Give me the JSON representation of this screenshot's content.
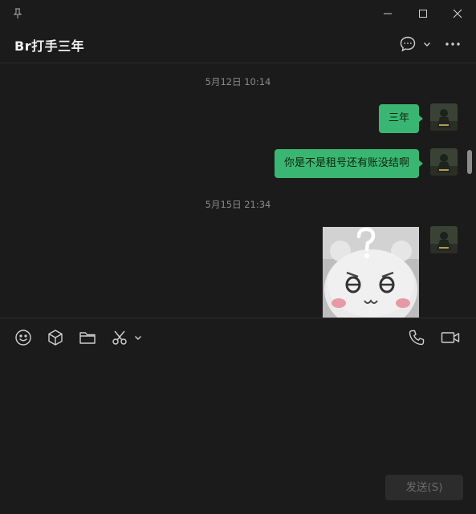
{
  "header": {
    "title": "Br打手三年"
  },
  "messages": {
    "timestamps": [
      "5月12日 10:14",
      "5月15日 21:34"
    ],
    "items": [
      {
        "type": "text",
        "sender": "self",
        "text": "三年"
      },
      {
        "type": "text",
        "sender": "self",
        "text": "你是不是租号还有账没结啊"
      },
      {
        "type": "image",
        "sender": "self"
      }
    ],
    "bubble_color": "#39b772"
  },
  "send": {
    "label": "发送(S)"
  },
  "icons": {
    "titlebar": [
      "pin-icon",
      "minimize-icon",
      "maximize-icon",
      "close-icon"
    ],
    "header": [
      "chat-bubble-icon",
      "chevron-down-icon",
      "more-icon"
    ],
    "toolbar": [
      "emoji-icon",
      "box-icon",
      "folder-icon",
      "scissors-icon",
      "chevron-down-icon",
      "phone-icon",
      "video-icon"
    ]
  }
}
